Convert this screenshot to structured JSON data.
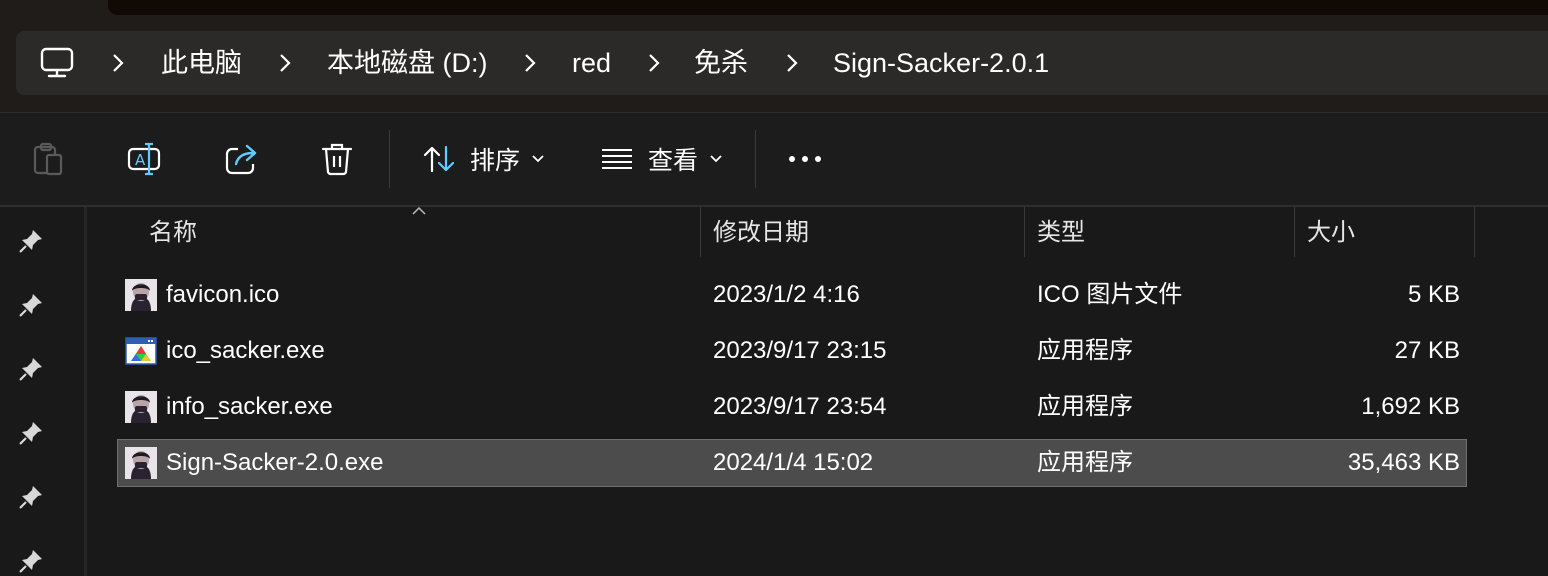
{
  "breadcrumb": {
    "items": [
      "此电脑",
      "本地磁盘 (D:)",
      "red",
      "免杀",
      "Sign-Sacker-2.0.1"
    ]
  },
  "toolbar": {
    "sort_label": "排序",
    "view_label": "查看"
  },
  "columns": {
    "name": "名称",
    "modified": "修改日期",
    "type": "类型",
    "size": "大小"
  },
  "files": [
    {
      "name": "favicon.ico",
      "modified": "2023/1/2 4:16",
      "type": "ICO 图片文件",
      "size": "5 KB",
      "icon": "avatar-image-icon",
      "selected": false
    },
    {
      "name": "ico_sacker.exe",
      "modified": "2023/9/17 23:15",
      "type": "应用程序",
      "size": "27 KB",
      "icon": "application-window-icon",
      "selected": false
    },
    {
      "name": "info_sacker.exe",
      "modified": "2023/9/17 23:54",
      "type": "应用程序",
      "size": "1,692 KB",
      "icon": "avatar-image-icon",
      "selected": false
    },
    {
      "name": "Sign-Sacker-2.0.exe",
      "modified": "2024/1/4 15:02",
      "type": "应用程序",
      "size": "35,463 KB",
      "icon": "avatar-image-icon",
      "selected": true
    }
  ],
  "colors": {
    "background": "#191919",
    "breadcrumb_bar": "#2b2a29",
    "selected_row": "#4c4c4c",
    "accent": "#60cdff"
  }
}
